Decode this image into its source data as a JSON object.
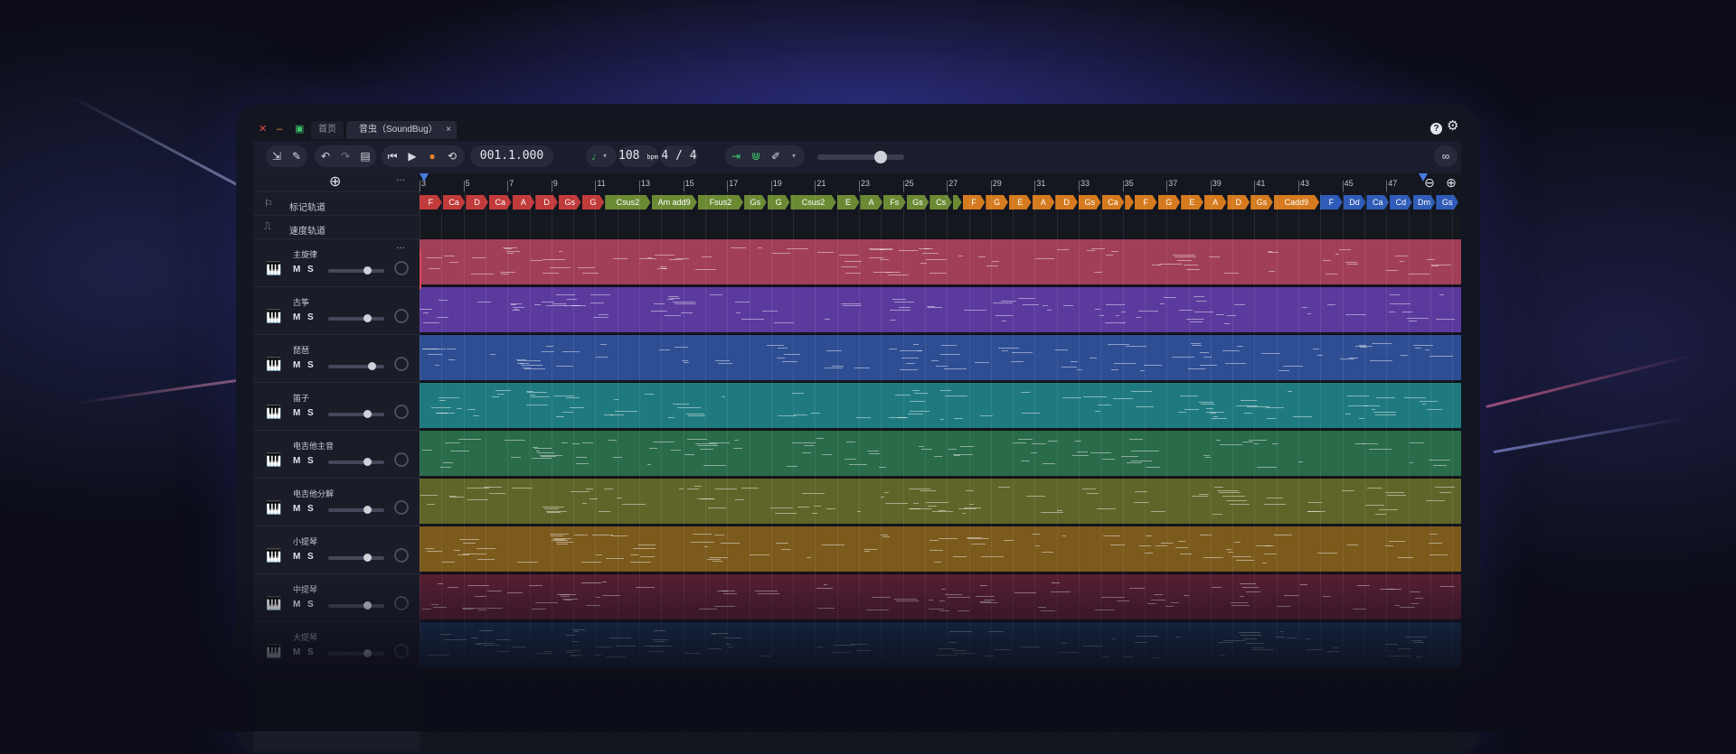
{
  "window": {
    "tabs": [
      {
        "label": "首页"
      },
      {
        "label": "音虫（SoundBug）"
      }
    ],
    "close_tab": "×"
  },
  "transport": {
    "position": "001.1.000",
    "tempo": "108",
    "tempo_unit": "bpm",
    "time_signature": "4 / 4"
  },
  "side": {
    "add": "⊕",
    "more": "···",
    "marker_track": "标记轨道",
    "tempo_track": "速度轨道",
    "mute": "M",
    "solo": "S"
  },
  "tracks": [
    {
      "name": "主旋律",
      "volume": 0.7,
      "color": "#a13f58"
    },
    {
      "name": "古筝",
      "volume": 0.7,
      "color": "#5b3a9e"
    },
    {
      "name": "琵琶",
      "volume": 0.78,
      "color": "#2e4e94"
    },
    {
      "name": "笛子",
      "volume": 0.7,
      "color": "#1f7a80"
    },
    {
      "name": "电吉他主音",
      "volume": 0.7,
      "color": "#2a6b4a"
    },
    {
      "name": "电吉他分解",
      "volume": 0.7,
      "color": "#616428"
    },
    {
      "name": "小提琴",
      "volume": 0.7,
      "color": "#7b5a1c"
    },
    {
      "name": "中提琴",
      "volume": 0.7,
      "color": "#5a1f34"
    },
    {
      "name": "大提琴",
      "volume": 0.7,
      "color": "#1a3358"
    }
  ],
  "ruler": {
    "bars": [
      "3",
      "5",
      "7",
      "9",
      "11",
      "13",
      "15",
      "17",
      "19",
      "21",
      "23",
      "25",
      "27",
      "29",
      "31",
      "33",
      "35",
      "37",
      "39",
      "41",
      "43",
      "45",
      "47"
    ]
  },
  "chords": [
    {
      "label": "F",
      "color": "#c23b3b"
    },
    {
      "label": "Ca",
      "color": "#c23b3b"
    },
    {
      "label": "D",
      "color": "#c23b3b"
    },
    {
      "label": "Ca",
      "color": "#c23b3b"
    },
    {
      "label": "A",
      "color": "#c23b3b"
    },
    {
      "label": "D",
      "color": "#c23b3b"
    },
    {
      "label": "Gs",
      "color": "#c23b3b"
    },
    {
      "label": "G",
      "color": "#c23b3b"
    },
    {
      "label": "Csus2",
      "color": "#6c8a34"
    },
    {
      "label": "Am add9",
      "color": "#6c8a34"
    },
    {
      "label": "Fsus2",
      "color": "#6c8a34"
    },
    {
      "label": "Gs",
      "color": "#6c8a34"
    },
    {
      "label": "G",
      "color": "#6c8a34"
    },
    {
      "label": "Csus2",
      "color": "#6c8a34"
    },
    {
      "label": "E",
      "color": "#6c8a34"
    },
    {
      "label": "A",
      "color": "#6c8a34"
    },
    {
      "label": "Fs",
      "color": "#6c8a34"
    },
    {
      "label": "Gs",
      "color": "#6c8a34"
    },
    {
      "label": "Cs",
      "color": "#6c8a34"
    },
    {
      "label": "",
      "color": "#6c8a34"
    },
    {
      "label": "F",
      "color": "#d57a1e"
    },
    {
      "label": "G",
      "color": "#d57a1e"
    },
    {
      "label": "E",
      "color": "#d57a1e"
    },
    {
      "label": "A",
      "color": "#d57a1e"
    },
    {
      "label": "D",
      "color": "#d57a1e"
    },
    {
      "label": "Gs",
      "color": "#d57a1e"
    },
    {
      "label": "Ca",
      "color": "#d57a1e"
    },
    {
      "label": "",
      "color": "#d57a1e"
    },
    {
      "label": "F",
      "color": "#d57a1e"
    },
    {
      "label": "G",
      "color": "#d57a1e"
    },
    {
      "label": "E",
      "color": "#d57a1e"
    },
    {
      "label": "A",
      "color": "#d57a1e"
    },
    {
      "label": "D",
      "color": "#d57a1e"
    },
    {
      "label": "Gs",
      "color": "#d57a1e"
    },
    {
      "label": "Cadd9",
      "color": "#d57a1e"
    },
    {
      "label": "F",
      "color": "#2f5cb8"
    },
    {
      "label": "Dd",
      "color": "#2f5cb8"
    },
    {
      "label": "Ca",
      "color": "#2f5cb8"
    },
    {
      "label": "Cd",
      "color": "#2f5cb8"
    },
    {
      "label": "Dm",
      "color": "#2f5cb8"
    },
    {
      "label": "Gs",
      "color": "#2f5cb8"
    }
  ],
  "icons": {
    "close": "close-icon",
    "minimize": "minimize-icon",
    "maximize": "maximize-icon",
    "help": "help-icon",
    "settings": "gear-icon",
    "export": "export-icon",
    "edit": "edit-icon",
    "undo": "undo-icon",
    "redo": "redo-icon",
    "save": "save-icon",
    "skip_back": "skip-back-icon",
    "play": "play-icon",
    "record": "record-icon",
    "loop": "loop-icon",
    "metronome": "metronome-icon",
    "snap": "magnet-icon",
    "pencil": "pencil-icon",
    "link": "link-icon",
    "zoom_out": "zoom-out-icon",
    "zoom_in": "zoom-in-icon",
    "piano": "piano-icon"
  }
}
